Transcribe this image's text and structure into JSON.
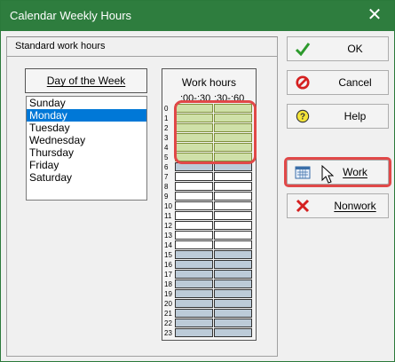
{
  "window": {
    "title": "Calendar Weekly Hours",
    "close_glyph": "✕"
  },
  "group": {
    "title": "Standard work hours"
  },
  "day_of_week": {
    "header": "Day of the Week",
    "items": [
      "Sunday",
      "Monday",
      "Tuesday",
      "Wednesday",
      "Thursday",
      "Friday",
      "Saturday"
    ],
    "selected": "Monday"
  },
  "work_hours": {
    "title": "Work hours",
    "col1": ":00-:30",
    "col2": ":30-:60",
    "hours": [
      "0",
      "1",
      "2",
      "3",
      "4",
      "5",
      "6",
      "7",
      "8",
      "9",
      "10",
      "11",
      "12",
      "13",
      "14",
      "15",
      "16",
      "17",
      "18",
      "19",
      "20",
      "21",
      "22",
      "23"
    ],
    "selected_rows": [
      0,
      1,
      2,
      3,
      4,
      5
    ],
    "white_rows": [
      7,
      8,
      9,
      10,
      11,
      12,
      13,
      14
    ]
  },
  "buttons": {
    "ok": "OK",
    "cancel": "Cancel",
    "help": "Help",
    "work": "Work",
    "nonwork": "Nonwork"
  },
  "colors": {
    "titlebar": "#2e7d3e",
    "selection": "#0078d7",
    "work_selected": "#cfe0a8",
    "nonwork_cell": "#bccbd8",
    "highlight": "#e04848"
  },
  "icons": {
    "ok": "check-icon",
    "cancel": "cancel-icon",
    "help": "help-icon",
    "work": "calendar-icon",
    "nonwork": "x-icon"
  }
}
